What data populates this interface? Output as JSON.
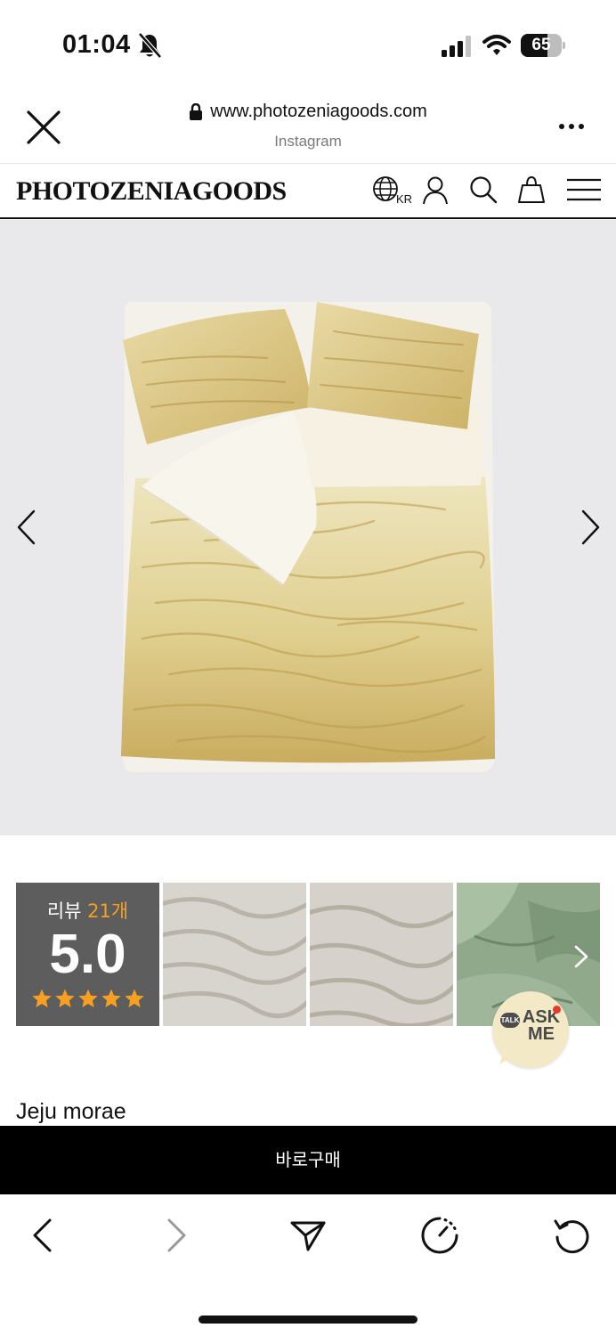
{
  "status_bar": {
    "time": "01:04",
    "battery_percent": "65",
    "battery_level": 0.65,
    "icons": [
      "bell-off-icon",
      "cellular-signal-icon",
      "wifi-icon",
      "battery-icon"
    ]
  },
  "browser": {
    "url": "www.photozeniagoods.com",
    "source": "Instagram"
  },
  "site": {
    "logo": "PHOTOZENIAGOODS",
    "language": "KR"
  },
  "reviews": {
    "label": "리뷰",
    "count": "21개",
    "score": "5.0",
    "stars": 5
  },
  "ask_me": {
    "talk": "TALK",
    "line1": "ASK",
    "line2": "ME"
  },
  "product": {
    "name": "Jeju morae"
  },
  "buy_button": {
    "label": "바로구매"
  },
  "colors": {
    "accent": "#000000",
    "star": "#f5a023",
    "review_bg": "#5d5d5d",
    "hero_bg": "#e9e9eb",
    "ask_bg": "#f3e9c6"
  }
}
